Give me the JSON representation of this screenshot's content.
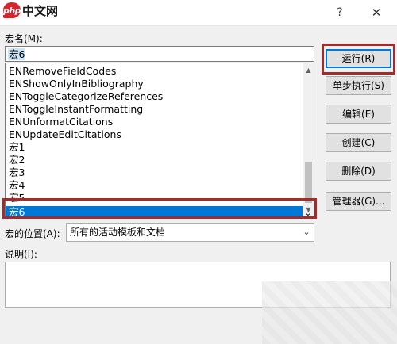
{
  "watermark": {
    "badge": "php",
    "text": "中文网"
  },
  "titlebar": {
    "help": "?",
    "close": "✕"
  },
  "macro_name": {
    "label": "宏名(M):",
    "value": "宏6"
  },
  "macro_list": {
    "items": [
      "ENRemoveFieldCodes",
      "ENShowOnlyInBibliography",
      "ENToggleCategorizeReferences",
      "ENToggleInstantFormatting",
      "ENUnformatCitations",
      "ENUpdateEditCitations",
      "宏1",
      "宏2",
      "宏3",
      "宏4",
      "宏5",
      "宏6"
    ],
    "selected_index": 11
  },
  "buttons": {
    "run": "运行(R)",
    "step": "单步执行(S)",
    "edit": "编辑(E)",
    "create": "创建(C)",
    "delete": "删除(D)",
    "organizer": "管理器(G)..."
  },
  "location": {
    "label": "宏的位置(A):",
    "value": "所有的活动模板和文档"
  },
  "description": {
    "label": "说明(I):",
    "value": ""
  },
  "icons": {
    "scroll_up": "▲",
    "scroll_down": "▼",
    "dropdown": "⌄",
    "selected_dropdown": "⌄"
  },
  "colors": {
    "selection": "#0078d7",
    "highlight_box": "#a52a2a"
  }
}
